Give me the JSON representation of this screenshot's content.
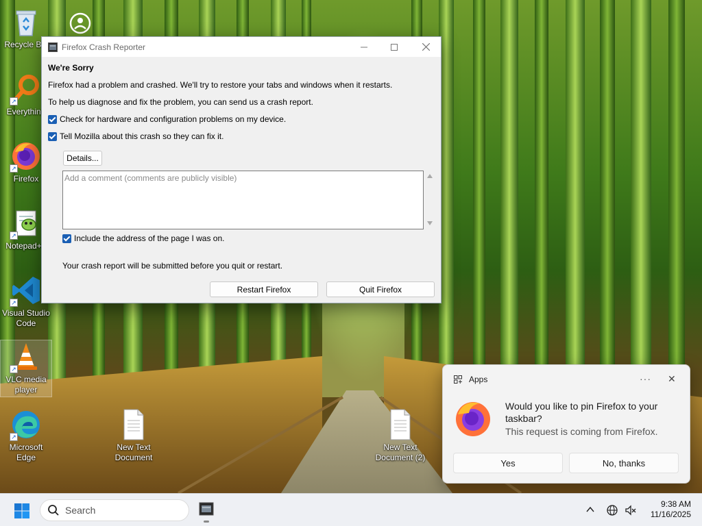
{
  "desktop": {
    "icons": [
      {
        "label": "Recycle Bin",
        "icon": "recycle-bin-icon"
      },
      {
        "label": "",
        "icon": "user-folder-icon"
      },
      {
        "label": "Everything",
        "icon": "everything-search-icon"
      },
      {
        "label": "Firefox",
        "icon": "firefox-icon"
      },
      {
        "label": "Notepad++",
        "icon": "notepad-plus-plus-icon"
      },
      {
        "label": "Visual Studio Code",
        "icon": "vscode-icon"
      },
      {
        "label": "VLC media player",
        "icon": "vlc-icon"
      },
      {
        "label": "Microsoft Edge",
        "icon": "edge-icon"
      },
      {
        "label": "New Text Document",
        "icon": "text-document-icon"
      },
      {
        "label": "New Text Document (2)",
        "icon": "text-document-icon"
      }
    ]
  },
  "crash_reporter": {
    "window_title": "Firefox Crash Reporter",
    "heading": "We're Sorry",
    "message": "Firefox had a problem and crashed. We'll try to restore your tabs and windows when it restarts.",
    "diagnose_text": "To help us diagnose and fix the problem, you can send us a crash report.",
    "check_hardware_label": "Check for hardware and configuration problems on my device.",
    "check_hardware_checked": true,
    "tell_mozilla_label": "Tell Mozilla about this crash so they can fix it.",
    "tell_mozilla_checked": true,
    "details_label": "Details...",
    "comment_placeholder": "Add a comment (comments are publicly visible)",
    "comment_value": "",
    "include_address_label": "Include the address of the page I was on.",
    "include_address_checked": true,
    "submit_note": "Your crash report will be submitted before you quit or restart.",
    "restart_label": "Restart Firefox",
    "quit_label": "Quit Firefox"
  },
  "notification": {
    "app_label": "Apps",
    "more_label": "···",
    "close_label": "✕",
    "message": "Would you like to pin Firefox to your taskbar?",
    "subtext": "This request is coming from Firefox.",
    "yes_label": "Yes",
    "no_label": "No, thanks"
  },
  "taskbar": {
    "search_placeholder": "Search",
    "clock_time": "9:38 AM",
    "clock_date": "11/16/2025"
  },
  "colors": {
    "accent": "#1a5fb4",
    "taskbar_bg": "#eef0f4",
    "window_bg": "#f0f0f0"
  }
}
